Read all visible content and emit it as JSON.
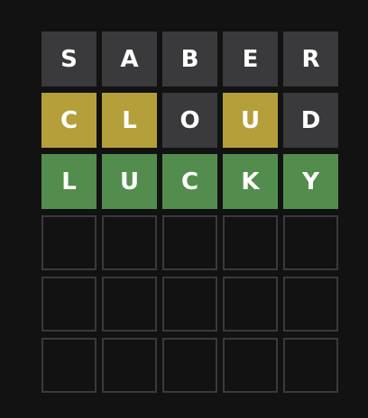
{
  "colors": {
    "background": "#121213",
    "absent": "#3a3a3c",
    "present": "#b59f3b",
    "correct": "#538d4e",
    "empty_border": "#3a3a3c",
    "letter": "#ffffff"
  },
  "board": {
    "rows": [
      [
        {
          "letter": "S",
          "state": "absent"
        },
        {
          "letter": "A",
          "state": "absent"
        },
        {
          "letter": "B",
          "state": "absent"
        },
        {
          "letter": "E",
          "state": "absent"
        },
        {
          "letter": "R",
          "state": "absent"
        }
      ],
      [
        {
          "letter": "C",
          "state": "present"
        },
        {
          "letter": "L",
          "state": "present"
        },
        {
          "letter": "O",
          "state": "absent"
        },
        {
          "letter": "U",
          "state": "present"
        },
        {
          "letter": "D",
          "state": "absent"
        }
      ],
      [
        {
          "letter": "L",
          "state": "correct"
        },
        {
          "letter": "U",
          "state": "correct"
        },
        {
          "letter": "C",
          "state": "correct"
        },
        {
          "letter": "K",
          "state": "correct"
        },
        {
          "letter": "Y",
          "state": "correct"
        }
      ],
      [
        {
          "letter": "",
          "state": "empty"
        },
        {
          "letter": "",
          "state": "empty"
        },
        {
          "letter": "",
          "state": "empty"
        },
        {
          "letter": "",
          "state": "empty"
        },
        {
          "letter": "",
          "state": "empty"
        }
      ],
      [
        {
          "letter": "",
          "state": "empty"
        },
        {
          "letter": "",
          "state": "empty"
        },
        {
          "letter": "",
          "state": "empty"
        },
        {
          "letter": "",
          "state": "empty"
        },
        {
          "letter": "",
          "state": "empty"
        }
      ],
      [
        {
          "letter": "",
          "state": "empty"
        },
        {
          "letter": "",
          "state": "empty"
        },
        {
          "letter": "",
          "state": "empty"
        },
        {
          "letter": "",
          "state": "empty"
        },
        {
          "letter": "",
          "state": "empty"
        }
      ]
    ]
  }
}
